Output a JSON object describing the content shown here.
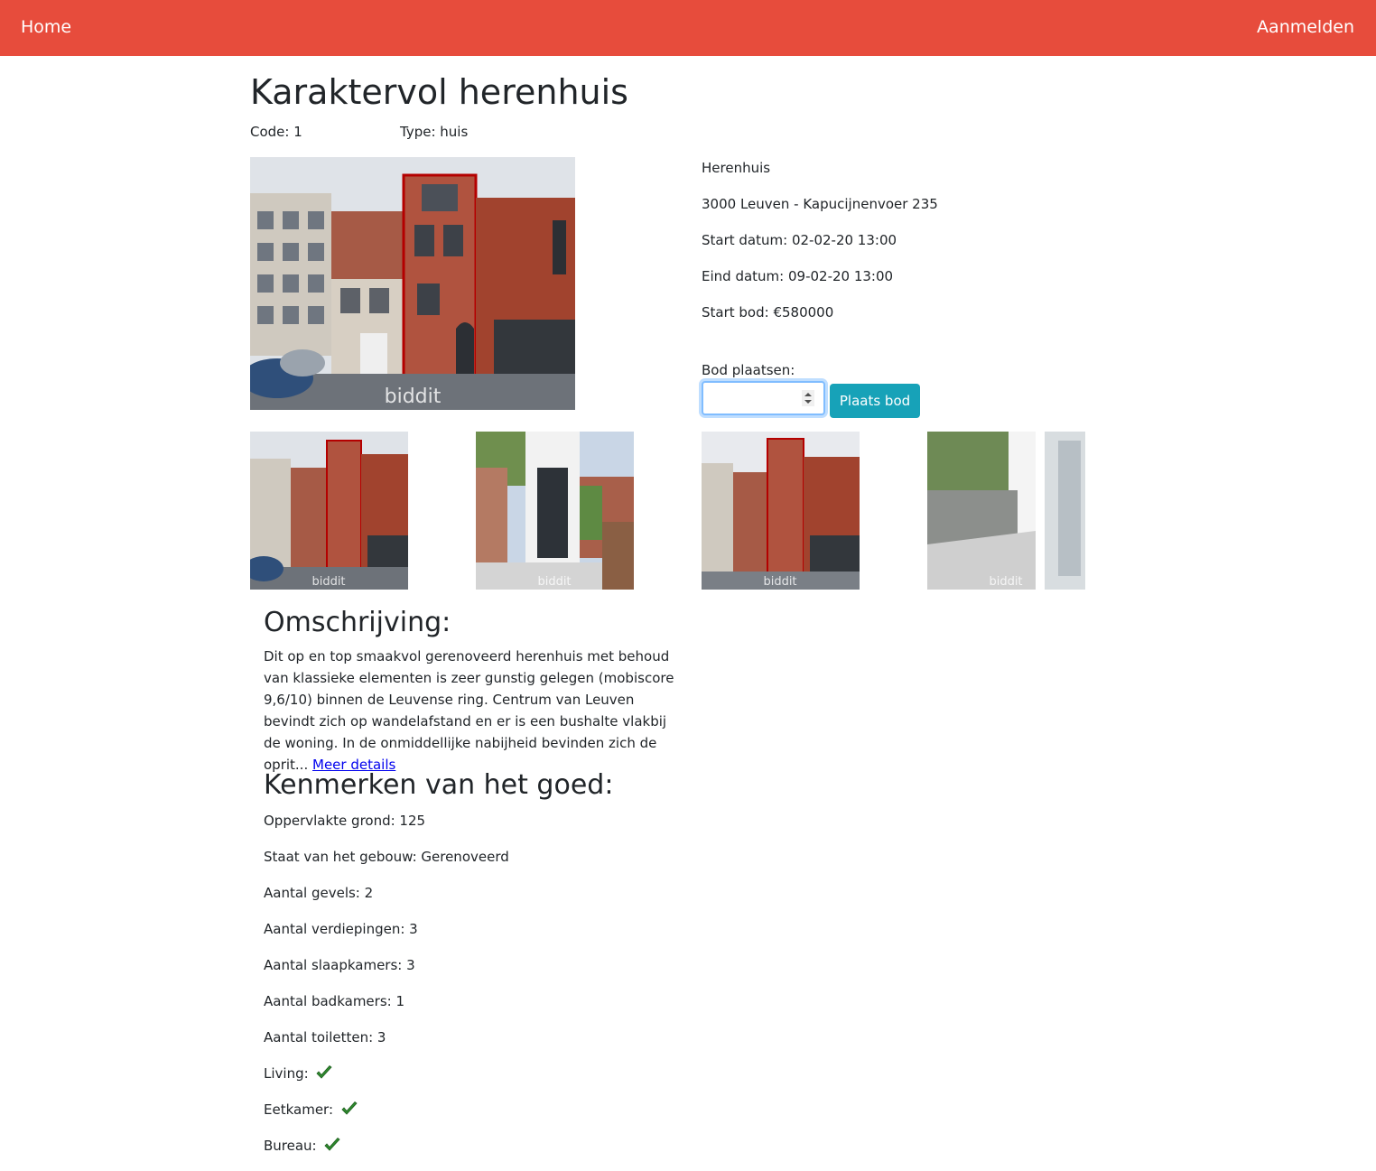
{
  "nav": {
    "home_label": "Home",
    "login_label": "Aanmelden"
  },
  "property": {
    "title": "Karaktervol herenhuis",
    "code": "Code: 1",
    "type": "Type: huis",
    "kind": "Herenhuis",
    "address": "3000 Leuven - Kapucijnenvoer 235",
    "start_date": "Start datum: 02-02-20 13:00",
    "end_date": "Eind datum: 09-02-20 13:00",
    "start_bid": "Start bod: €580000"
  },
  "bid": {
    "label": "Bod plaatsen:",
    "value": "",
    "button_label": "Plaats bod"
  },
  "description": {
    "heading": "Omschrijving:",
    "text": "Dit op en top smaakvol gerenoveerd herenhuis met behoud van klassieke elementen is zeer gunstig gelegen (mobiscore 9,6/10) binnen de Leuvense ring. Centrum van Leuven bevindt zich op wandelafstand en er is een bushalte vlakbij de woning. In de onmiddellijke nabijheid bevinden zich de oprit...",
    "more_link": "Meer details"
  },
  "features": {
    "heading": "Kenmerken van het goed:",
    "items": [
      "Oppervlakte grond: 125",
      "Staat van het gebouw: Gerenoveerd",
      "Aantal gevels: 2",
      "Aantal verdiepingen: 3",
      "Aantal slaapkamers: 3",
      "Aantal badkamers: 1",
      "Aantal toiletten: 3",
      "Living:",
      "Eetkamer:",
      "Bureau:"
    ]
  },
  "photos": {
    "watermark": "biddit"
  },
  "colors": {
    "navbar": "#e74c3c",
    "button": "#17a2b8",
    "check": "#2e8b2e"
  }
}
